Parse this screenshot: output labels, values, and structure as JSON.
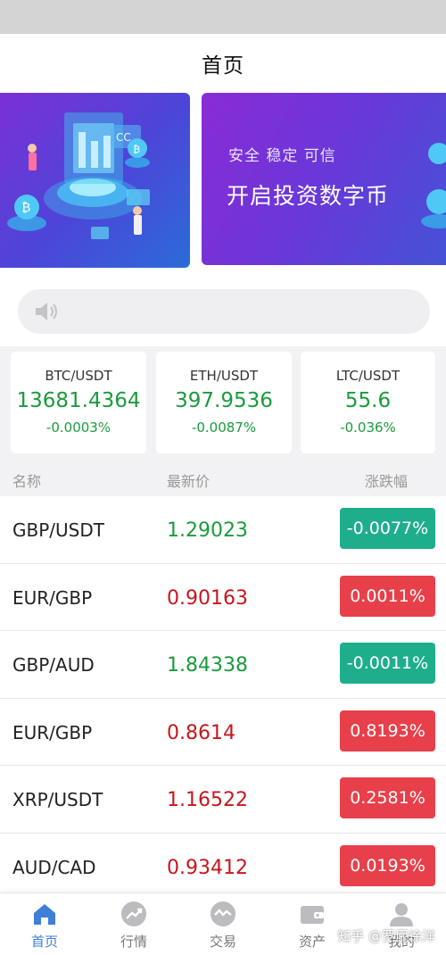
{
  "header": {
    "title": "首页"
  },
  "banner": {
    "tag_line": "安全 稳定 可信",
    "headline": "开启投资数字币",
    "cc_glyph": "CC",
    "coin_glyph": "₿"
  },
  "tickers": [
    {
      "pair": "BTC/USDT",
      "price": "13681.4364",
      "change": "-0.0003%"
    },
    {
      "pair": "ETH/USDT",
      "price": "397.9536",
      "change": "-0.0087%"
    },
    {
      "pair": "LTC/USDT",
      "price": "55.6",
      "change": "-0.036%"
    }
  ],
  "table": {
    "headers": {
      "name": "名称",
      "price": "最新价",
      "change": "涨跌幅"
    },
    "rows": [
      {
        "name": "GBP/USDT",
        "price": "1.29023",
        "change": "-0.0077%",
        "direction": "down"
      },
      {
        "name": "EUR/GBP",
        "price": "0.90163",
        "change": "0.0011%",
        "direction": "up"
      },
      {
        "name": "GBP/AUD",
        "price": "1.84338",
        "change": "-0.0011%",
        "direction": "down"
      },
      {
        "name": "EUR/GBP",
        "price": "0.8614",
        "change": "0.8193%",
        "direction": "up"
      },
      {
        "name": "XRP/USDT",
        "price": "1.16522",
        "change": "0.2581%",
        "direction": "up"
      },
      {
        "name": "AUD/CAD",
        "price": "0.93412",
        "change": "0.0193%",
        "direction": "up"
      }
    ]
  },
  "colors": {
    "down_price": "#1a9b3c",
    "up_price": "#c8161d",
    "down_badge": "#1fae8c",
    "up_badge": "#e8404a",
    "accent": "#3f7fd6"
  },
  "tabs": [
    {
      "label": "首页",
      "icon": "home-icon",
      "active": true
    },
    {
      "label": "行情",
      "icon": "trend-icon",
      "active": false
    },
    {
      "label": "交易",
      "icon": "exchange-icon",
      "active": false
    },
    {
      "label": "资产",
      "icon": "wallet-icon",
      "active": false
    },
    {
      "label": "我的",
      "icon": "user-icon",
      "active": false
    }
  ],
  "watermark": "知乎 @罗屁徐洋"
}
